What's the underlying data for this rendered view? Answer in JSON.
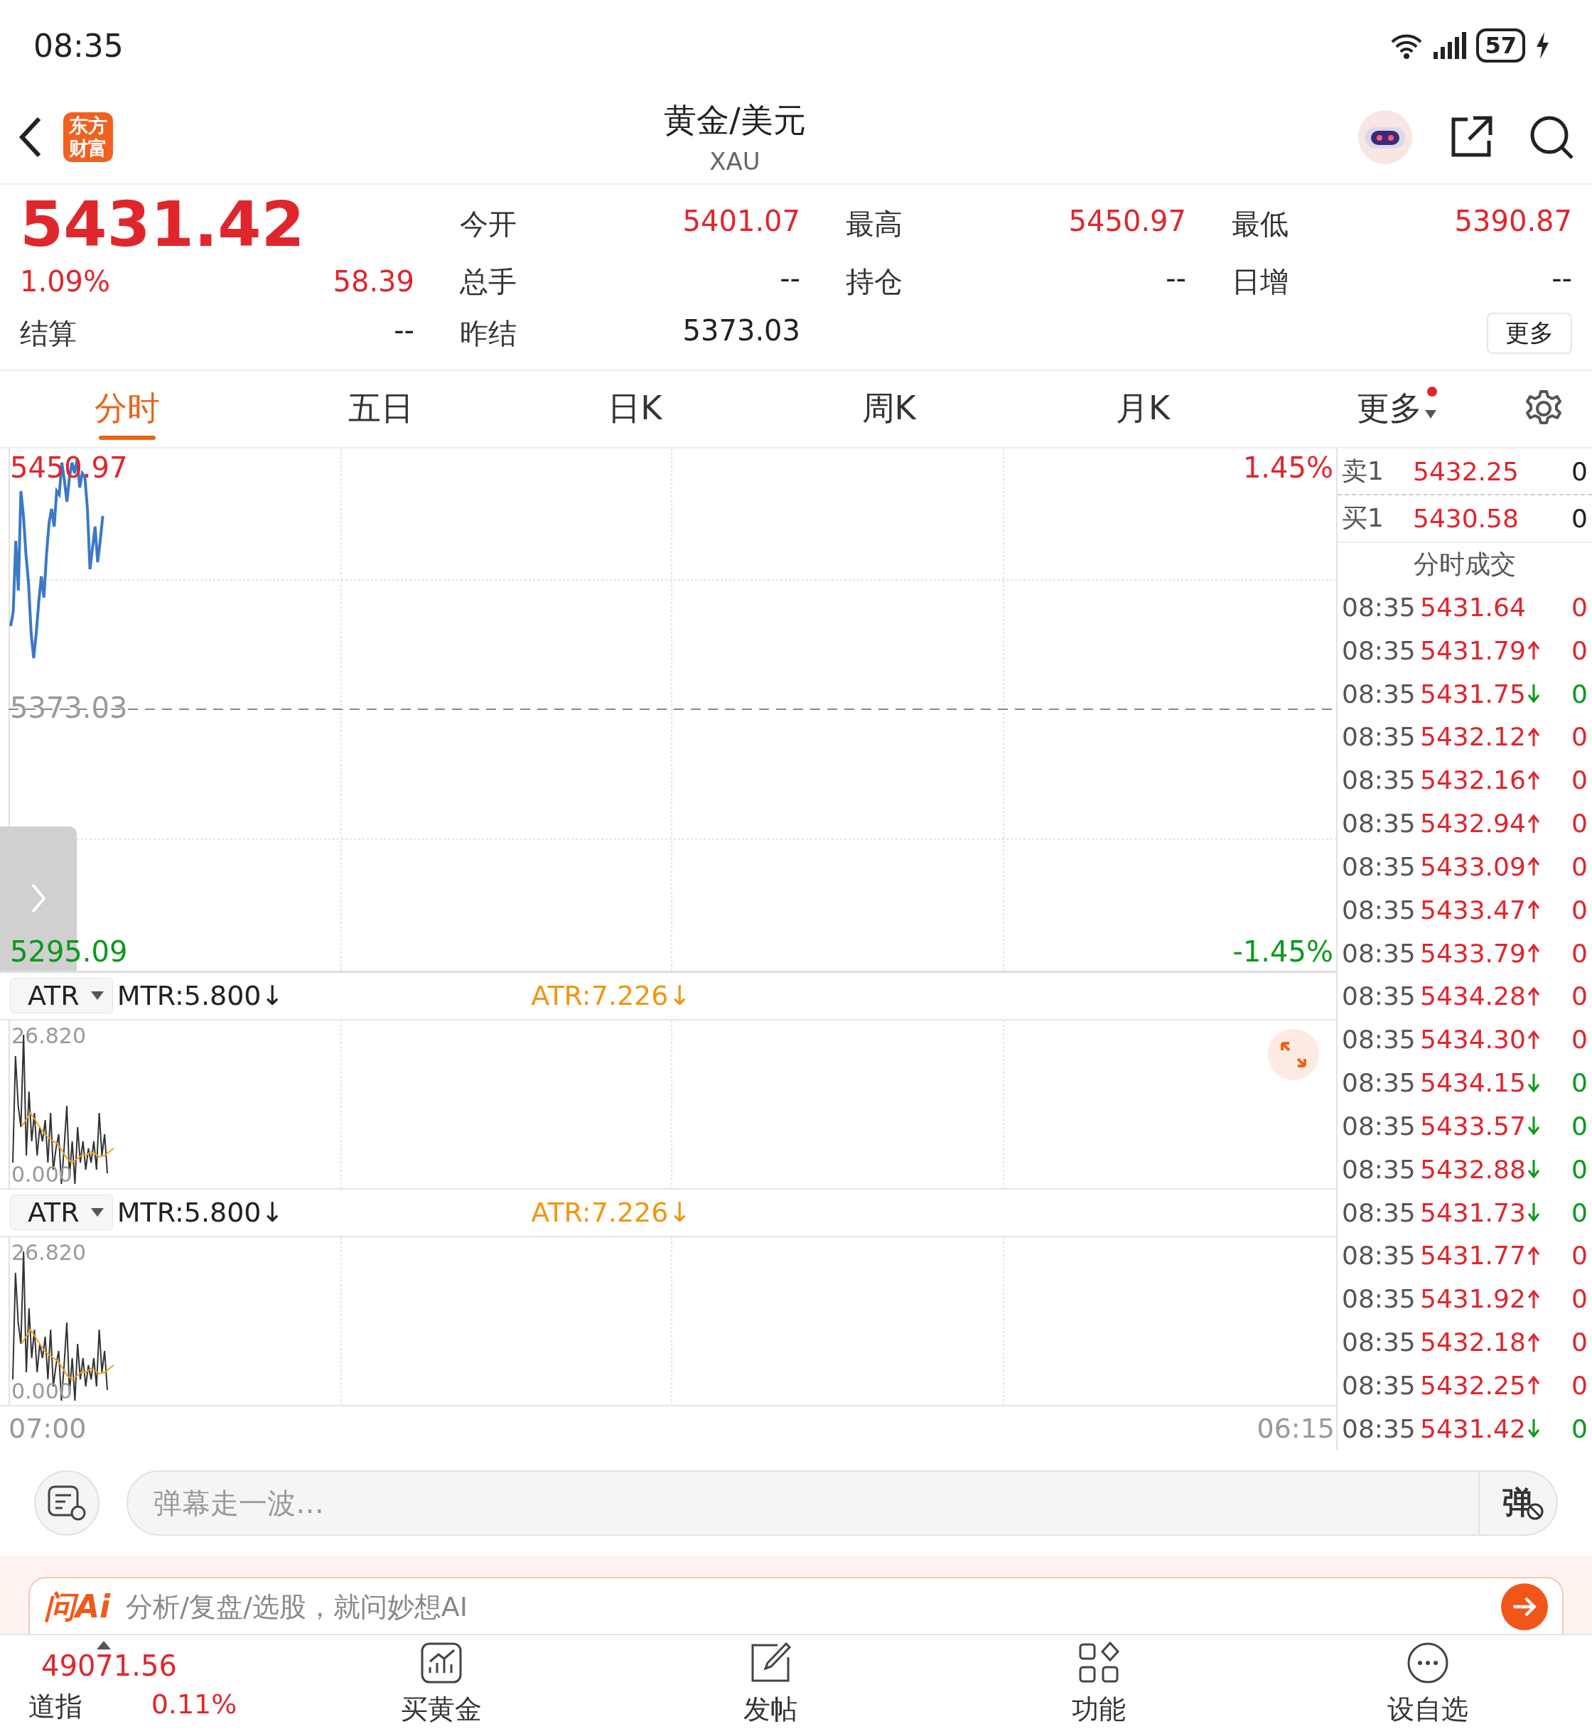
{
  "status_bar": {
    "time": "08:35",
    "battery": "57"
  },
  "header": {
    "logo": "东方财富",
    "title": "黄金/美元",
    "subtitle": "XAU"
  },
  "quote": {
    "price": "5431.42",
    "change_pct": "1.09%",
    "change": "58.39",
    "settle_label": "结算",
    "settle_value": "--",
    "more": "更多",
    "fields": [
      {
        "label": "今开",
        "value": "5401.07",
        "kind": "up"
      },
      {
        "label": "最高",
        "value": "5450.97",
        "kind": "up"
      },
      {
        "label": "最低",
        "value": "5390.87",
        "kind": "up"
      },
      {
        "label": "总手",
        "value": "--",
        "kind": "flat"
      },
      {
        "label": "持仓",
        "value": "--",
        "kind": "flat"
      },
      {
        "label": "日增",
        "value": "--",
        "kind": "flat"
      },
      {
        "label": "昨结",
        "value": "5373.03",
        "kind": "flat"
      }
    ]
  },
  "tabs": [
    {
      "label": "分时",
      "selected": true,
      "kind": "plain",
      "badge": false
    },
    {
      "label": "五日",
      "selected": false,
      "kind": "plain",
      "badge": false
    },
    {
      "label": "日K",
      "selected": false,
      "kind": "plain",
      "badge": false
    },
    {
      "label": "周K",
      "selected": false,
      "kind": "plain",
      "badge": false
    },
    {
      "label": "月K",
      "selected": false,
      "kind": "plain",
      "badge": false
    },
    {
      "label": "更多",
      "selected": false,
      "kind": "menu",
      "badge": true
    }
  ],
  "main_chart": {
    "high": "5450.97",
    "high_pct": "1.45%",
    "base": "5373.03",
    "low": "5295.09",
    "low_pct": "-1.45%"
  },
  "indicators": [
    {
      "name": "ATR",
      "mtr": "MTR:5.800↓",
      "atr": "ATR:7.226↓",
      "max": "26.820",
      "min": "0.000",
      "expand": true
    },
    {
      "name": "ATR",
      "mtr": "MTR:5.800↓",
      "atr": "ATR:7.226↓",
      "max": "26.820",
      "min": "0.000",
      "expand": false
    }
  ],
  "time_axis": {
    "start": "07:00",
    "end": "06:15"
  },
  "book": {
    "levels": [
      {
        "label": "卖1",
        "price": "5432.25",
        "vol": "0"
      },
      {
        "label": "买1",
        "price": "5430.58",
        "vol": "0"
      }
    ],
    "trades_title": "分时成交",
    "trades": [
      {
        "time": "08:35",
        "price": "5431.64",
        "kind": "flat",
        "vol": "0"
      },
      {
        "time": "08:35",
        "price": "5431.79",
        "kind": "up",
        "vol": "0"
      },
      {
        "time": "08:35",
        "price": "5431.75",
        "kind": "down",
        "vol": "0"
      },
      {
        "time": "08:35",
        "price": "5432.12",
        "kind": "up",
        "vol": "0"
      },
      {
        "time": "08:35",
        "price": "5432.16",
        "kind": "up",
        "vol": "0"
      },
      {
        "time": "08:35",
        "price": "5432.94",
        "kind": "up",
        "vol": "0"
      },
      {
        "time": "08:35",
        "price": "5433.09",
        "kind": "up",
        "vol": "0"
      },
      {
        "time": "08:35",
        "price": "5433.47",
        "kind": "up",
        "vol": "0"
      },
      {
        "time": "08:35",
        "price": "5433.79",
        "kind": "up",
        "vol": "0"
      },
      {
        "time": "08:35",
        "price": "5434.28",
        "kind": "up",
        "vol": "0"
      },
      {
        "time": "08:35",
        "price": "5434.30",
        "kind": "up",
        "vol": "0"
      },
      {
        "time": "08:35",
        "price": "5434.15",
        "kind": "down",
        "vol": "0"
      },
      {
        "time": "08:35",
        "price": "5433.57",
        "kind": "down",
        "vol": "0"
      },
      {
        "time": "08:35",
        "price": "5432.88",
        "kind": "down",
        "vol": "0"
      },
      {
        "time": "08:35",
        "price": "5431.73",
        "kind": "down",
        "vol": "0"
      },
      {
        "time": "08:35",
        "price": "5431.77",
        "kind": "up",
        "vol": "0"
      },
      {
        "time": "08:35",
        "price": "5431.92",
        "kind": "up",
        "vol": "0"
      },
      {
        "time": "08:35",
        "price": "5432.18",
        "kind": "up",
        "vol": "0"
      },
      {
        "time": "08:35",
        "price": "5432.25",
        "kind": "up",
        "vol": "0"
      },
      {
        "time": "08:35",
        "price": "5431.42",
        "kind": "down",
        "vol": "0"
      }
    ]
  },
  "comment_bar": {
    "placeholder": "弹幕走一波…",
    "danmaku": "弹"
  },
  "ai_bar": {
    "logo": "问Ai",
    "placeholder": "分析/复盘/选股，就问妙想AI"
  },
  "nav": {
    "ticker": {
      "price": "49071.56",
      "name": "道指",
      "change": "0.11%"
    },
    "items": [
      {
        "label": "买黄金",
        "kind": "chart"
      },
      {
        "label": "发帖",
        "kind": "edit"
      },
      {
        "label": "功能",
        "kind": "apps"
      },
      {
        "label": "设自选",
        "kind": "more"
      }
    ]
  }
}
